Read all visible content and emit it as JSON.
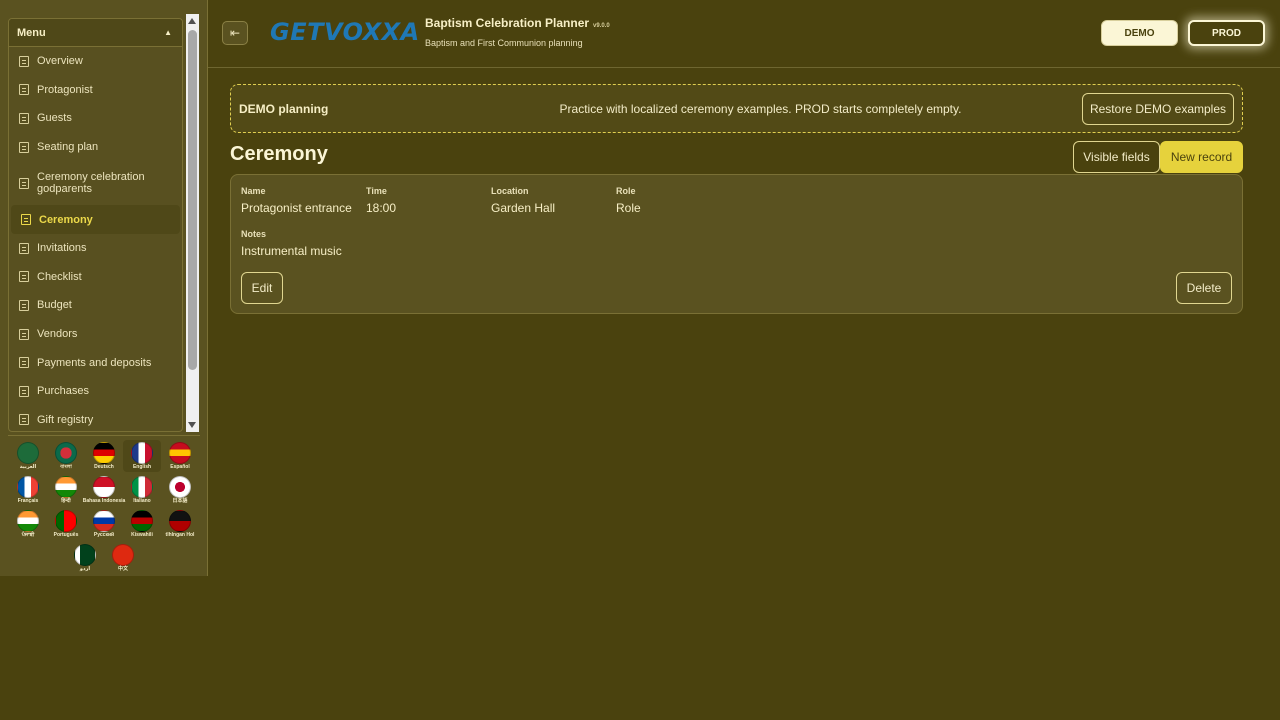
{
  "sidebar": {
    "menu_title": "Menu",
    "items": [
      {
        "label": "Overview"
      },
      {
        "label": "Protagonist"
      },
      {
        "label": "Guests"
      },
      {
        "label": "Seating plan"
      },
      {
        "label": "Ceremony celebration godparents"
      },
      {
        "label": "Ceremony"
      },
      {
        "label": "Invitations"
      },
      {
        "label": "Checklist"
      },
      {
        "label": "Budget"
      },
      {
        "label": "Vendors"
      },
      {
        "label": "Payments and deposits"
      },
      {
        "label": "Purchases"
      },
      {
        "label": "Gift registry"
      }
    ],
    "active_item": "Ceremony",
    "languages": [
      {
        "label": "العربية",
        "colors": [
          "#1d6b3a",
          "#1d6b3a"
        ]
      },
      {
        "label": "বাংলা",
        "colors": [
          "#0b6a4a",
          "#d32f3a"
        ]
      },
      {
        "label": "Deutsch",
        "colors": [
          "#000000",
          "#dd0000",
          "#ffce00"
        ]
      },
      {
        "label": "English",
        "colors": [
          "#1e3a8a",
          "#ffffff",
          "#c8102e"
        ]
      },
      {
        "label": "Español",
        "colors": [
          "#c60b1e",
          "#ffc400",
          "#c60b1e"
        ]
      },
      {
        "label": "Français",
        "colors": [
          "#0055a4",
          "#ffffff",
          "#ef4135"
        ]
      },
      {
        "label": "हिन्दी",
        "colors": [
          "#ff9933",
          "#ffffff",
          "#138808"
        ]
      },
      {
        "label": "Bahasa Indonesia",
        "colors": [
          "#ce1126",
          "#ffffff"
        ]
      },
      {
        "label": "Italiano",
        "colors": [
          "#009246",
          "#ffffff",
          "#ce2b37"
        ]
      },
      {
        "label": "日本語",
        "colors": [
          "#ffffff",
          "#bc002d"
        ]
      },
      {
        "label": "ਪੰਜਾਬੀ",
        "colors": [
          "#ff9933",
          "#ffffff",
          "#138808"
        ]
      },
      {
        "label": "Português",
        "colors": [
          "#006600",
          "#ff0000"
        ]
      },
      {
        "label": "Русский",
        "colors": [
          "#ffffff",
          "#0039a6",
          "#d52b1e"
        ]
      },
      {
        "label": "Kiswahili",
        "colors": [
          "#000000",
          "#bb0000",
          "#006600"
        ]
      },
      {
        "label": "tlhIngan Hol",
        "colors": [
          "#111111",
          "#b00000"
        ]
      },
      {
        "label": "اردو",
        "colors": [
          "#01411c",
          "#ffffff"
        ]
      },
      {
        "label": "中文",
        "colors": [
          "#de2910",
          "#de2910"
        ]
      }
    ],
    "selected_language": "English"
  },
  "header": {
    "logo_text": "GETVOXXA",
    "title": "Baptism Celebration Planner",
    "version": "v9.0.0",
    "subtitle": "Baptism and First Communion planning",
    "demo_label": "DEMO",
    "prod_label": "PROD"
  },
  "banner": {
    "title": "DEMO planning",
    "text": "Practice with localized ceremony examples. PROD starts completely empty.",
    "restore_label": "Restore DEMO examples"
  },
  "section": {
    "title": "Ceremony",
    "visible_fields_label": "Visible fields",
    "new_record_label": "New record"
  },
  "record": {
    "fields": {
      "name": {
        "label": "Name",
        "value": "Protagonist entrance"
      },
      "time": {
        "label": "Time",
        "value": "18:00"
      },
      "location": {
        "label": "Location",
        "value": "Garden Hall"
      },
      "role": {
        "label": "Role",
        "value": "Role"
      },
      "notes": {
        "label": "Notes",
        "value": "Instrumental music"
      }
    },
    "edit_label": "Edit",
    "delete_label": "Delete"
  },
  "colors": {
    "background": "#4a420e",
    "accent": "#e6d23c",
    "sidebar": "#5a5220"
  }
}
